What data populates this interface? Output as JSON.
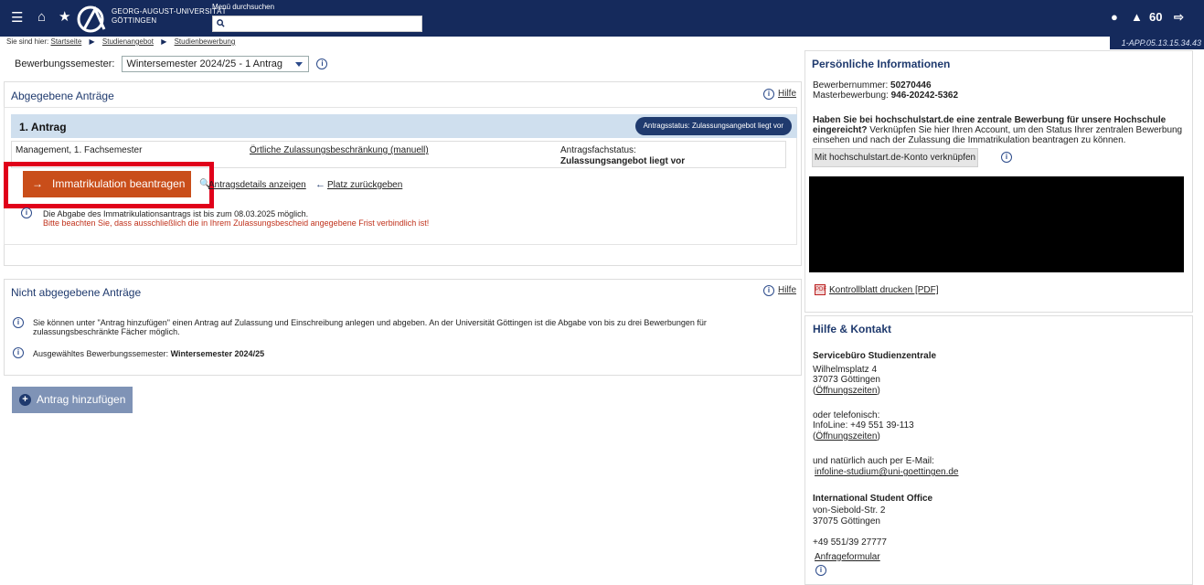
{
  "header": {
    "university_line1": "GEORG-AUGUST-UNIVERSITÄT",
    "university_line2": "GÖTTINGEN",
    "search_label": "Menü durchsuchen",
    "notif_count": "60",
    "version": "1-APP.05.13.15.34.43"
  },
  "breadcrumb": {
    "prefix": "Sie sind hier:",
    "items": [
      "Startseite",
      "Studienangebot",
      "Studienbewerbung"
    ]
  },
  "semester": {
    "label": "Bewerbungssemester:",
    "value": "Wintersemester 2024/25 - 1 Antrag"
  },
  "submitted": {
    "title": "Abgegebene Anträge",
    "help": "Hilfe",
    "antrag_title": "1. Antrag",
    "status_pill": "Antragsstatus: Zulassungsangebot liegt vor",
    "program": "Management, 1. Fachsemester",
    "restriction": "Örtliche Zulassungsbeschränkung (manuell)",
    "fach_status_label": "Antragsfachstatus:",
    "fach_status_value": "Zulassungsangebot liegt vor",
    "btn_immat": "Immatrikulation beantragen",
    "link_details": "Antragsdetails anzeigen",
    "link_return": "Platz zurückgeben",
    "note1": "Die Abgabe des Immatrikulationsantrags ist bis zum 08.03.2025 möglich.",
    "note2": "Bitte beachten Sie, dass ausschließlich die in Ihrem Zulassungsbescheid angegebene Frist verbindlich ist!"
  },
  "not_submitted": {
    "title": "Nicht abgegebene Anträge",
    "help": "Hilfe",
    "info1_line1": "Sie können unter \"Antrag hinzufügen\" einen Antrag auf Zulassung und Einschreibung anlegen und abgeben. An der Universität Göttingen ist die Abgabe von bis zu drei Bewerbungen für",
    "info1_line2": "zulassungsbeschränkte Fächer möglich.",
    "info2_prefix": "Ausgewähltes Bewerbungssemester:",
    "info2_value": "Wintersemester 2024/25"
  },
  "add_button": "Antrag hinzufügen",
  "personal": {
    "title": "Persönliche Informationen",
    "bewerbernummer_label": "Bewerbernummer:",
    "bewerbernummer": "50270446",
    "master_label": "Masterbewerbung:",
    "master": "946-20242-5362",
    "q_bold": "Haben Sie bei hochschulstart.de eine zentrale Bewerbung für unsere Hochschule eingereicht?",
    "q_rest": " Verknüpfen Sie hier Ihren Account, um den Status Ihrer zentralen Bewerbung einsehen und nach der Zulassung die Immatrikulation beantragen zu können.",
    "link_btn": "Mit hochschulstart.de-Konto verknüpfen",
    "pdf_link": "Kontrollblatt drucken [PDF]"
  },
  "contact": {
    "title": "Hilfe & Kontakt",
    "office": "Servicebüro Studienzentrale",
    "street": "Wilhelmsplatz 4",
    "city": "37073 Göttingen",
    "hours1": "Öffnungszeiten",
    "phone_intro": "oder telefonisch:",
    "phone": "InfoLine: +49 551 39-113",
    "hours2": "Öffnungszeiten",
    "email_intro": "und natürlich auch per E-Mail:",
    "email": "infoline-studium@uni-goettingen.de",
    "iso": "International Student Office",
    "iso_street": "von-Siebold-Str. 2",
    "iso_city": "37075 Göttingen",
    "iso_phone": "+49 551/39 27777",
    "iso_form": "Anfrageformular"
  }
}
